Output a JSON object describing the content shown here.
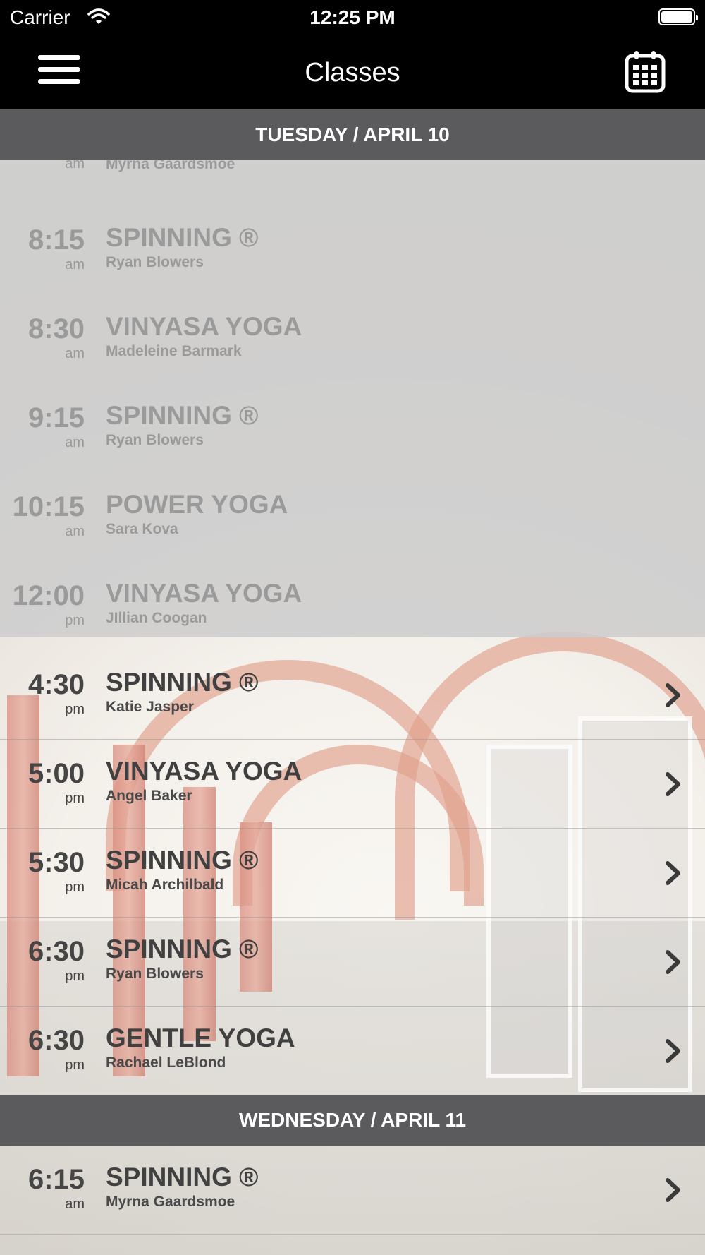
{
  "status_bar": {
    "carrier": "Carrier",
    "time": "12:25 PM"
  },
  "nav": {
    "title": "Classes"
  },
  "icons": {
    "menu": "hamburger-icon",
    "calendar": "calendar-icon",
    "chevron": "chevron-right-icon",
    "wifi": "wifi-icon",
    "battery": "battery-icon"
  },
  "days": [
    {
      "header": "TUESDAY / APRIL 10",
      "classes": [
        {
          "time": "",
          "ampm": "am",
          "name": "",
          "instructor": "Myrna Gaardsmoe"
        },
        {
          "time": "8:15",
          "ampm": "am",
          "name": "SPINNING ®",
          "instructor": "Ryan Blowers"
        },
        {
          "time": "8:30",
          "ampm": "am",
          "name": "VINYASA YOGA",
          "instructor": "Madeleine Barmark"
        },
        {
          "time": "9:15",
          "ampm": "am",
          "name": "SPINNING ®",
          "instructor": "Ryan Blowers"
        },
        {
          "time": "10:15",
          "ampm": "am",
          "name": "POWER YOGA",
          "instructor": "Sara Kova"
        },
        {
          "time": "12:00",
          "ampm": "pm",
          "name": "VINYASA YOGA",
          "instructor": "JIllian Coogan"
        },
        {
          "time": "4:30",
          "ampm": "pm",
          "name": "SPINNING ®",
          "instructor": "Katie Jasper"
        },
        {
          "time": "5:00",
          "ampm": "pm",
          "name": "VINYASA YOGA",
          "instructor": "Angel Baker"
        },
        {
          "time": "5:30",
          "ampm": "pm",
          "name": "SPINNING ®",
          "instructor": "Micah Archilbald"
        },
        {
          "time": "6:30",
          "ampm": "pm",
          "name": "SPINNING ®",
          "instructor": "Ryan Blowers"
        },
        {
          "time": "6:30",
          "ampm": "pm",
          "name": "GENTLE YOGA",
          "instructor": "Rachael LeBlond"
        }
      ]
    },
    {
      "header": "WEDNESDAY / APRIL 11",
      "classes": [
        {
          "time": "6:15",
          "ampm": "am",
          "name": "SPINNING ®",
          "instructor": "Myrna Gaardsmoe"
        }
      ]
    }
  ]
}
